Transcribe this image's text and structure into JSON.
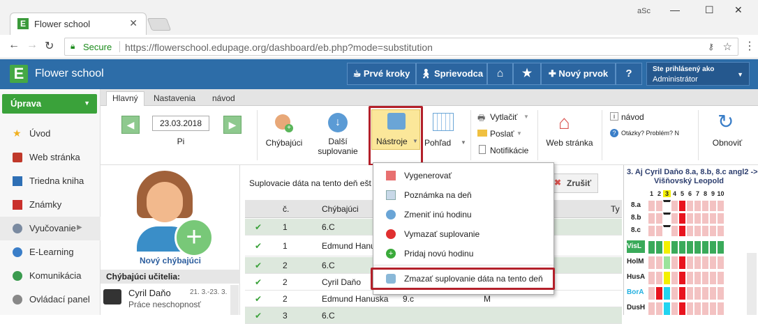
{
  "browser": {
    "tab_title": "Flower school",
    "url_secure": "Secure",
    "url": "https://flowerschool.edupage.org/dashboard/eb.php?mode=substitution",
    "profile_badge": "aSc"
  },
  "header": {
    "app_name": "Flower school",
    "buttons": {
      "first_steps": "Prvé kroky",
      "guide": "Sprievodca",
      "new_item": "Nový prvok",
      "help": "?"
    },
    "login_label": "Ste prihlásený ako",
    "login_user": "Administrátor"
  },
  "sidebar": {
    "main_button": "Úprava",
    "items": [
      {
        "label": "Úvod",
        "icon": "star-icon"
      },
      {
        "label": "Web stránka",
        "icon": "web-icon"
      },
      {
        "label": "Triedna kniha",
        "icon": "book-icon"
      },
      {
        "label": "Známky",
        "icon": "grades-icon"
      },
      {
        "label": "Vyučovanie",
        "icon": "teaching-icon"
      },
      {
        "label": "E-Learning",
        "icon": "elearning-icon"
      },
      {
        "label": "Komunikácia",
        "icon": "communication-icon"
      },
      {
        "label": "Ovládací panel",
        "icon": "control-panel-icon"
      }
    ]
  },
  "ribbon": {
    "tabs": [
      "Hlavný",
      "Nastavenia",
      "návod"
    ],
    "date": "23.03.2018",
    "day": "Pi",
    "absent": "Chýbajúci",
    "next_sub_1": "Další",
    "next_sub_2": "suplovanie",
    "tools": "Nástroje",
    "view": "Pohľad",
    "print": "Vytlačiť",
    "send": "Poslať",
    "notifications": "Notifikácie",
    "website": "Web stránka",
    "guide": "návod",
    "question": "Otázky? Problém? N",
    "refresh": "Obnoviť"
  },
  "left": {
    "new_absent": "Nový chýbajúci",
    "section_title": "Chýbajúci učitelia:",
    "teacher_name": "Cyril Daňo",
    "teacher_dates": "21. 3.-23. 3.",
    "teacher_reason": "Práce neschopnosť"
  },
  "main": {
    "info_text": "Suplovacie dáta na tento deň ešt",
    "cancel": "Zrušiť",
    "col_no": "č.",
    "col_absent": "Chýbajúci",
    "col_type": "Ty",
    "rows": [
      {
        "no": "1",
        "absent": "6.C",
        "cls": "",
        "type": ""
      },
      {
        "no": "1",
        "absent": "Edmund Hanusk",
        "cls": "",
        "type": ""
      },
      {
        "no": "2",
        "absent": "6.C",
        "cls": "",
        "type": ""
      },
      {
        "no": "2",
        "absent": "Cyril Daňo",
        "cls": "",
        "type": ""
      },
      {
        "no": "2",
        "absent": "Edmund Hanuska",
        "cls": "9.c",
        "type": "M"
      },
      {
        "no": "3",
        "absent": "6.C",
        "cls": "",
        "type": ""
      }
    ]
  },
  "menu": {
    "items": [
      "Vygenerovať",
      "Poznámka na deň",
      "Zmeniť inú hodinu",
      "Vymazať suplovanie",
      "Pridaj novú hodinu",
      "Zmazať suplovanie dáta na tento deň"
    ]
  },
  "timetable": {
    "title": "3. Aj Cyril Daňo 8.a, 8.b, 8.c angl2 ->",
    "subtitle": "Višňovský Leopold",
    "periods": [
      "1",
      "2",
      "3",
      "4",
      "5",
      "6",
      "7",
      "8",
      "9",
      "10"
    ],
    "classes": [
      "8.a",
      "8.b",
      "8.c"
    ],
    "teachers": [
      "VisL",
      "HolM",
      "HusA",
      "BorA",
      "DusH"
    ],
    "colors": {
      "pink": "#f3c2c2",
      "red": "#e8141e",
      "green": "#3aaa5a",
      "yellow": "#f4f000",
      "cyan": "#22d4f0"
    }
  }
}
